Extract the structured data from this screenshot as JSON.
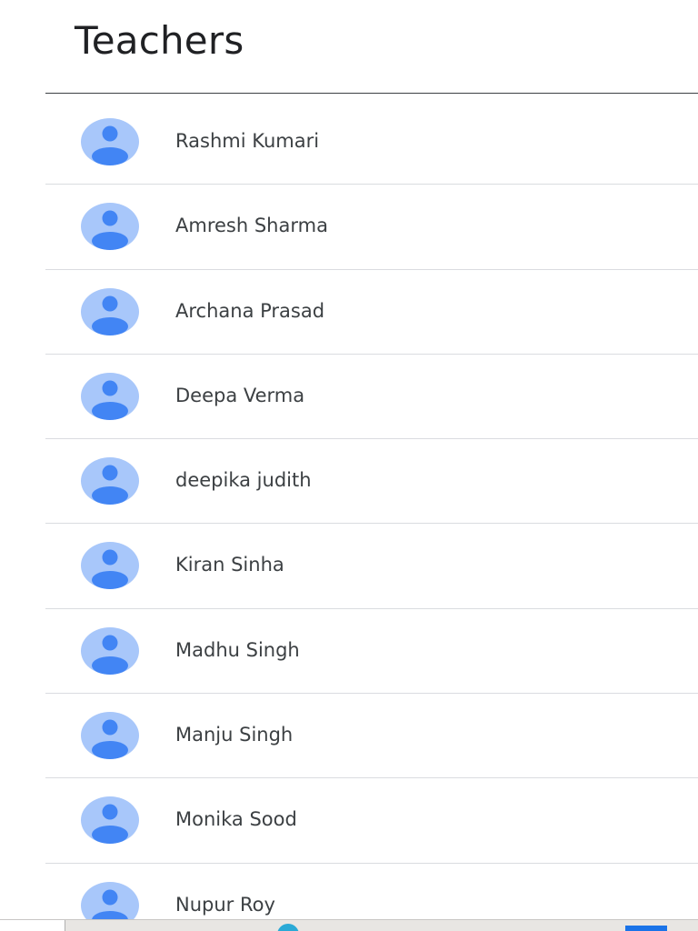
{
  "section": {
    "title": "Teachers"
  },
  "teachers": [
    {
      "name": "Rashmi Kumari",
      "avatar_icon": "person-icon"
    },
    {
      "name": "Amresh Sharma",
      "avatar_icon": "person-icon"
    },
    {
      "name": "Archana Prasad",
      "avatar_icon": "person-icon"
    },
    {
      "name": "Deepa Verma",
      "avatar_icon": "person-icon"
    },
    {
      "name": "deepika judith",
      "avatar_icon": "person-icon"
    },
    {
      "name": "Kiran Sinha",
      "avatar_icon": "person-icon"
    },
    {
      "name": "Madhu Singh",
      "avatar_icon": "person-icon"
    },
    {
      "name": "Manju Singh",
      "avatar_icon": "person-icon"
    },
    {
      "name": "Monika Sood",
      "avatar_icon": "person-icon"
    },
    {
      "name": "Nupur Roy",
      "avatar_icon": "person-icon"
    }
  ],
  "colors": {
    "avatar_background": "#a8c7fa",
    "avatar_figure": "#4285f4",
    "title_text": "#202124",
    "name_text": "#3c4043",
    "divider": "#dadce0"
  }
}
